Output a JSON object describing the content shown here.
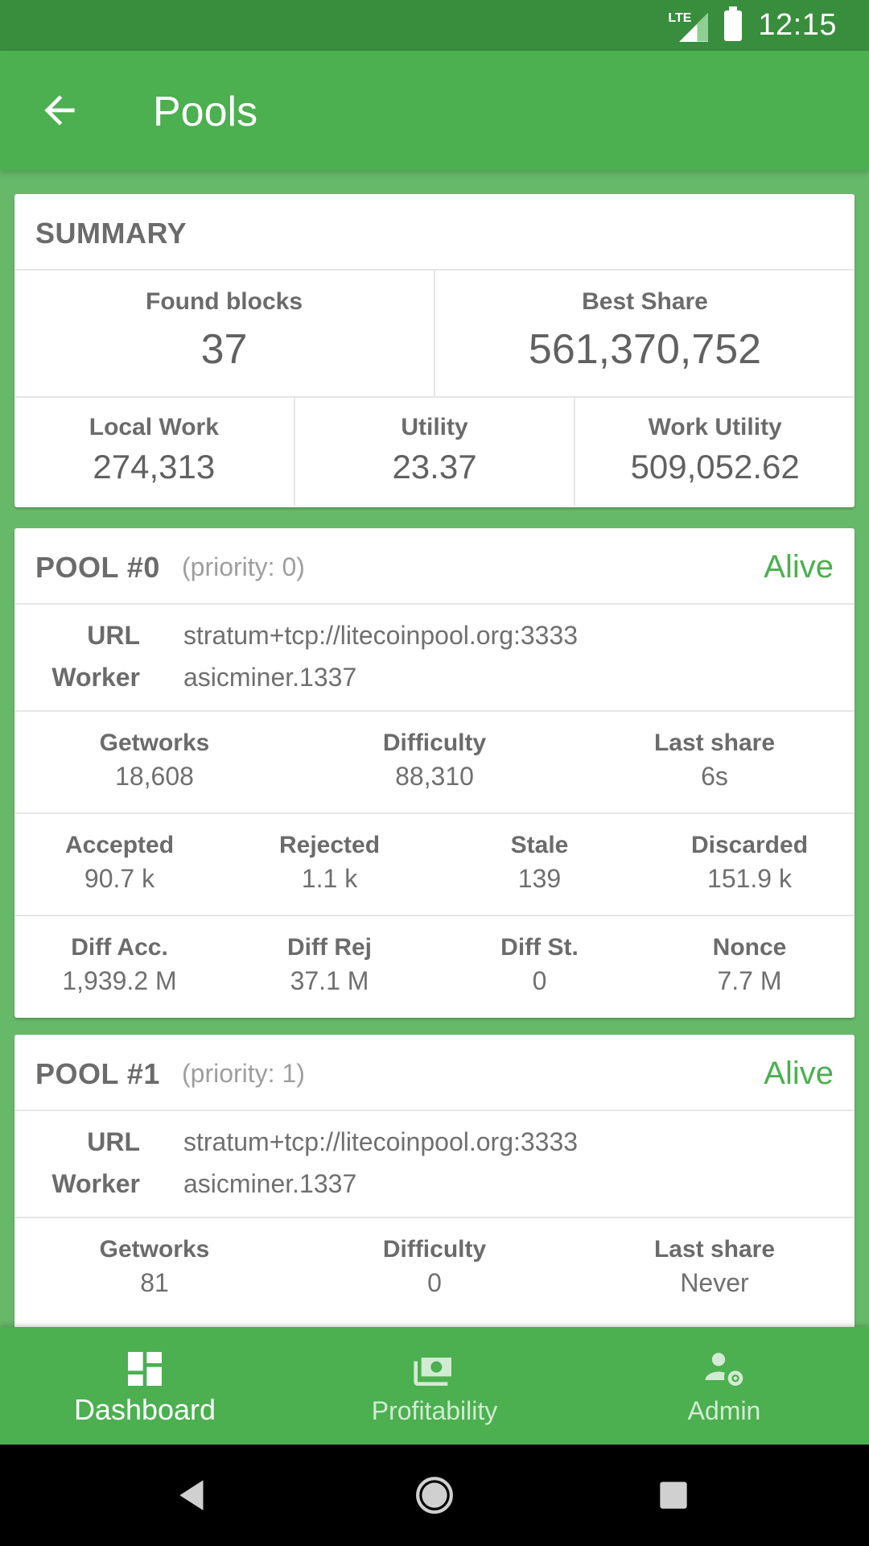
{
  "status_bar": {
    "time": "12:15",
    "network": "LTE"
  },
  "app_bar": {
    "title": "Pools"
  },
  "summary": {
    "title": "SUMMARY",
    "found_blocks": {
      "label": "Found blocks",
      "value": "37"
    },
    "best_share": {
      "label": "Best Share",
      "value": "561,370,752"
    },
    "local_work": {
      "label": "Local Work",
      "value": "274,313"
    },
    "utility": {
      "label": "Utility",
      "value": "23.37"
    },
    "work_utility": {
      "label": "Work Utility",
      "value": "509,052.62"
    }
  },
  "labels": {
    "url": "URL",
    "worker": "Worker",
    "getworks": "Getworks",
    "difficulty": "Difficulty",
    "last_share": "Last share",
    "accepted": "Accepted",
    "rejected": "Rejected",
    "stale": "Stale",
    "discarded": "Discarded",
    "diff_acc": "Diff Acc.",
    "diff_rej": "Diff Rej",
    "diff_st": "Diff St.",
    "nonce": "Nonce"
  },
  "pools": [
    {
      "title": "POOL #0",
      "priority": "(priority: 0)",
      "status": "Alive",
      "url": "stratum+tcp://litecoinpool.org:3333",
      "worker": "asicminer.1337",
      "getworks": "18,608",
      "difficulty": "88,310",
      "last_share": "6s",
      "accepted": "90.7 k",
      "rejected": "1.1 k",
      "stale": "139",
      "discarded": "151.9 k",
      "diff_acc": "1,939.2 M",
      "diff_rej": "37.1 M",
      "diff_st": "0",
      "nonce": "7.7 M"
    },
    {
      "title": "POOL #1",
      "priority": "(priority: 1)",
      "status": "Alive",
      "url": "stratum+tcp://litecoinpool.org:3333",
      "worker": "asicminer.1337",
      "getworks": "81",
      "difficulty": "0",
      "last_share": "Never"
    }
  ],
  "bottom_nav": [
    {
      "label": "Dashboard",
      "icon": "dashboard-icon",
      "active": true
    },
    {
      "label": "Profitability",
      "icon": "cash-icon",
      "active": false
    },
    {
      "label": "Admin",
      "icon": "admin-settings-icon",
      "active": false
    }
  ],
  "colors": {
    "primary": "#4caf50",
    "status_bar": "#388e3c",
    "alive": "#4caf50"
  }
}
